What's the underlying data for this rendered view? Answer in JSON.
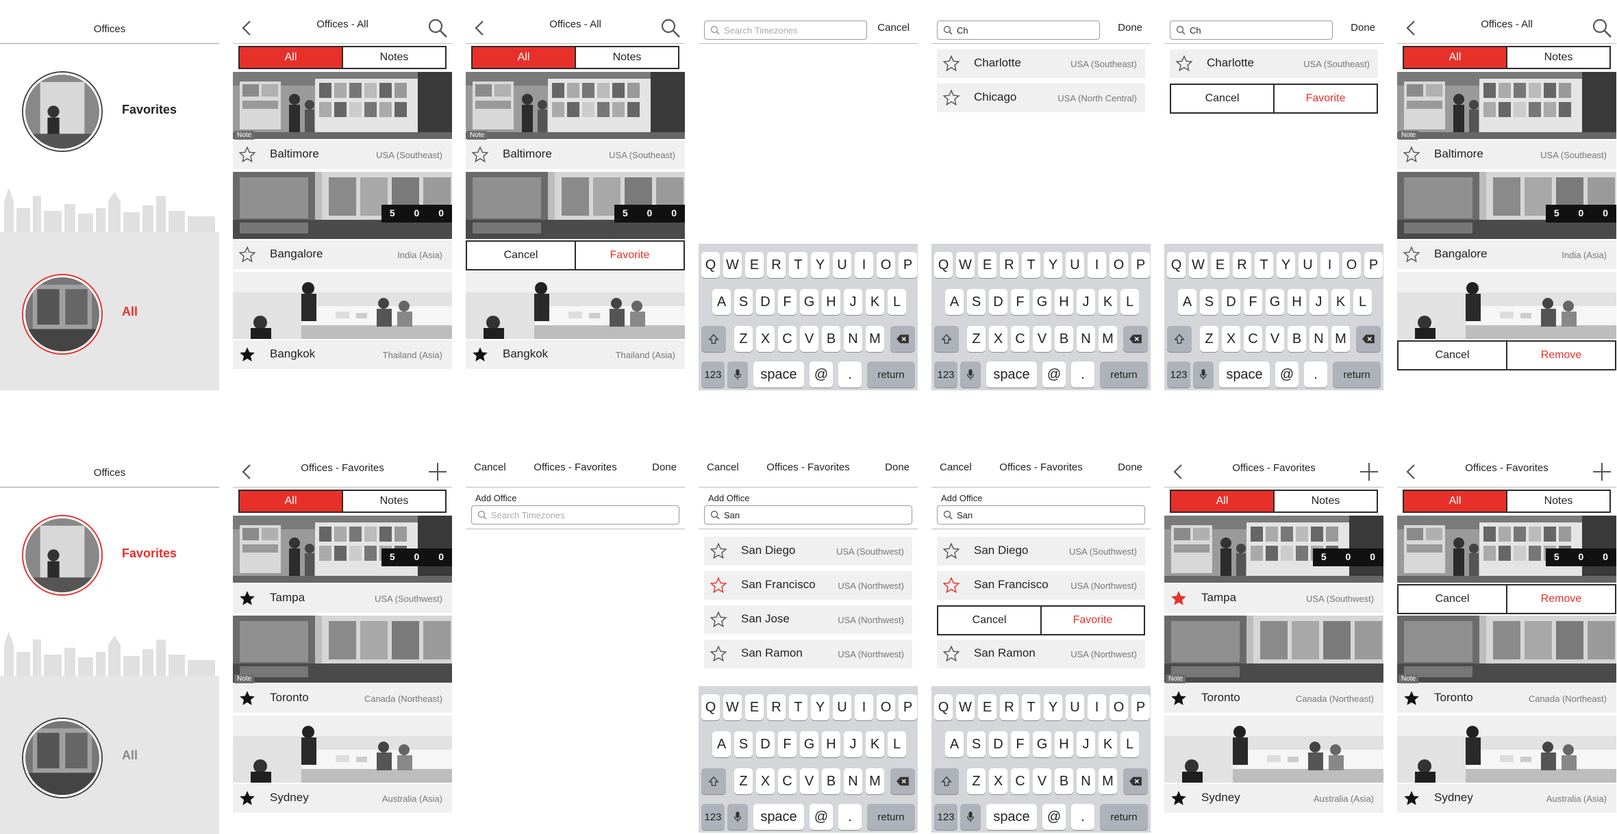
{
  "colors": {
    "accent": "#e8302a",
    "dark": "#2b2b2b",
    "rowbg": "#f0f0f0",
    "keyboard": "#d4d6da"
  },
  "menu_top": {
    "title": "Offices",
    "item1": "Favorites",
    "item2": "All"
  },
  "menu_bottom": {
    "title": "Offices",
    "item1": "Favorites",
    "item2": "All"
  },
  "seg": {
    "all": "All",
    "notes": "Notes"
  },
  "common": {
    "cancel": "Cancel",
    "done": "Done",
    "favorite": "Favorite",
    "remove": "Remove",
    "note": "Note",
    "counter": "500",
    "add_office": "Add Office",
    "search_placeholder": "Search Timezones"
  },
  "all_list": {
    "title": "Offices - All",
    "items": [
      {
        "city": "Baltimore",
        "region": "USA (Southeast)",
        "fav": false,
        "note": true
      },
      {
        "city": "Bangalore",
        "region": "India (Asia)",
        "fav": false,
        "counter": true
      },
      {
        "city": "Bangkok",
        "region": "Thailand (Asia)",
        "fav": true
      }
    ]
  },
  "fav_list": {
    "title": "Offices - Favorites",
    "items": [
      {
        "city": "Tampa",
        "region": "USA (Southwest)",
        "fav": true,
        "counter": true
      },
      {
        "city": "Toronto",
        "region": "Canada (Northeast)",
        "fav": true,
        "note": true
      },
      {
        "city": "Sydney",
        "region": "Australia (Asia)",
        "fav": true
      }
    ]
  },
  "search_ch": {
    "query": "Ch",
    "results": [
      {
        "city": "Charlotte",
        "region": "USA (Southeast)",
        "fav": false
      },
      {
        "city": "Chicago",
        "region": "USA (North Central)",
        "fav": false
      }
    ]
  },
  "search_san": {
    "query": "San",
    "results": [
      {
        "city": "San Diego",
        "region": "USA (Southwest)",
        "fav": false
      },
      {
        "city": "San Francisco",
        "region": "USA (Northwest)",
        "fav": true
      },
      {
        "city": "San Jose",
        "region": "USA (Northwest)",
        "fav": false
      },
      {
        "city": "San Ramon",
        "region": "USA (Northwest)",
        "fav": false
      }
    ]
  },
  "keyboard": {
    "row1": [
      "Q",
      "W",
      "E",
      "R",
      "T",
      "Y",
      "U",
      "I",
      "O",
      "P"
    ],
    "row2": [
      "A",
      "S",
      "D",
      "F",
      "G",
      "H",
      "J",
      "K",
      "L"
    ],
    "row3": [
      "Z",
      "X",
      "C",
      "V",
      "B",
      "N",
      "M"
    ],
    "num": "123",
    "space": "space",
    "at": "@",
    "dot": ".",
    "ret": "return"
  }
}
